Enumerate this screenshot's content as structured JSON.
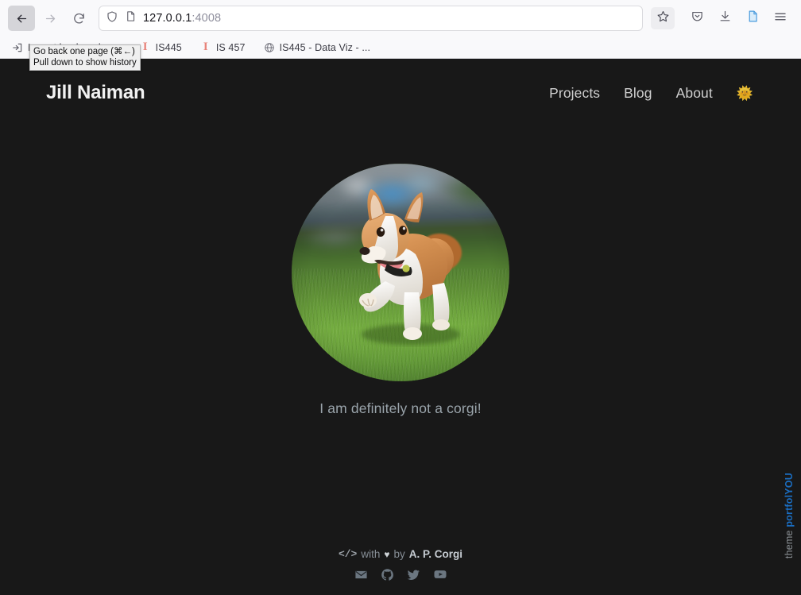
{
  "browser": {
    "back_tooltip": {
      "line1": "Go back one page (⌘←)",
      "line2": "Pull down to show history"
    },
    "url": {
      "host": "127.0.0.1",
      "port": ":4008"
    },
    "icons": {
      "back": "back-arrow-icon",
      "forward": "forward-arrow-icon",
      "reload": "reload-icon",
      "shield": "tracking-protection-shield-icon",
      "page": "page-info-icon",
      "bookmark_star": "bookmark-star-icon",
      "pocket": "pocket-icon",
      "downloads": "downloads-icon",
      "reader": "reader-view-icon",
      "menu": "hamburger-menu-icon"
    },
    "bookmarks": [
      {
        "label": "Import bookmarks",
        "icon": "import-bookmarks-icon"
      },
      {
        "label": "IS445",
        "icon": "illinois-icon"
      },
      {
        "label": "IS 457",
        "icon": "illinois-icon"
      },
      {
        "label": "IS445 - Data Viz - ...",
        "icon": "globe-icon"
      }
    ]
  },
  "site": {
    "brand": "Jill Naiman",
    "nav": [
      {
        "label": "Projects"
      },
      {
        "label": "Blog"
      },
      {
        "label": "About"
      }
    ],
    "theme_toggle": "🌞",
    "hero": {
      "avatar_alt": "corgi-photo",
      "caption": "I am definitely not a corgi!"
    },
    "ribbon": {
      "prefix": "theme ",
      "name": "portfolYOU"
    },
    "footer": {
      "code_glyph": "</>",
      "with": "with",
      "heart": "♥",
      "by": "by",
      "author": "A. P. Corgi",
      "socials": [
        {
          "name": "email-icon"
        },
        {
          "name": "github-icon"
        },
        {
          "name": "twitter-icon"
        },
        {
          "name": "youtube-icon"
        }
      ]
    }
  },
  "colors": {
    "page_bg": "#181818",
    "accent_blue": "#1b6ec2",
    "muted_text": "#868e96"
  }
}
